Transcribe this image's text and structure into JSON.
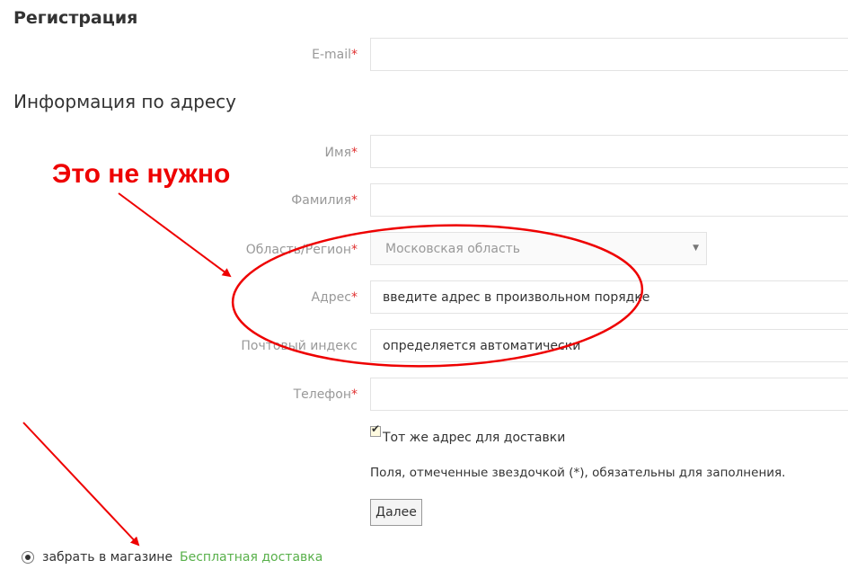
{
  "registration": {
    "title": "Регистрация",
    "email_label": "E-mail",
    "required_mark": "*"
  },
  "address_info": {
    "title": "Информация по адресу",
    "first_name_label": "Имя",
    "last_name_label": "Фамилия",
    "region_label": "Область/Регион",
    "region_value": "Московская область",
    "address_label": "Адрес",
    "address_placeholder": "введите адрес в произвольном порядке",
    "postal_label": "Почтовый индекс",
    "postal_placeholder": "определяется автоматически",
    "phone_label": "Телефон",
    "same_address_label": "Тот же адрес для доставки",
    "same_address_checked": true,
    "required_note": "Поля, отмеченные звездочкой (*), обязательны для заполнения.",
    "next_button": "Далее"
  },
  "delivery": {
    "pickup_label": "забрать в магазине",
    "pickup_selected": true,
    "free_delivery_label": "Бесплатная доставка"
  },
  "annotation": {
    "text": "Это не нужно",
    "color": "#ee0000"
  },
  "icons": {
    "select_caret": "caret-down-icon",
    "checkmark": "check-icon",
    "radio": "radio-selected-icon"
  }
}
